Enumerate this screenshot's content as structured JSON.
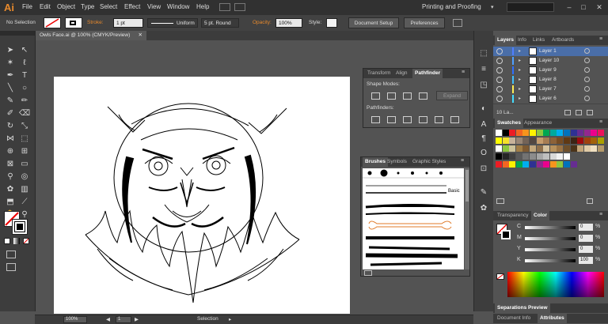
{
  "app": {
    "logo": "Ai"
  },
  "menu": [
    "File",
    "Edit",
    "Object",
    "Type",
    "Select",
    "Effect",
    "View",
    "Window",
    "Help"
  ],
  "workspace": "Printing and Proofing",
  "window_controls": {
    "minimize": "–",
    "maximize": "□",
    "close": "✕"
  },
  "control_bar": {
    "selection_label": "No Selection",
    "stroke_label": "Stroke:",
    "stroke_weight": "1 pt",
    "profile": "Uniform",
    "brush": "5 pt. Round",
    "opacity_label": "Opacity:",
    "opacity": "100%",
    "style_label": "Style:",
    "document_setup": "Document Setup",
    "preferences": "Preferences"
  },
  "document_tab": {
    "title": "Owls Face.ai @ 100% (CMYK/Preview)",
    "close": "✕"
  },
  "pathfinder_panel": {
    "tabs": [
      "Transform",
      "Align",
      "Pathfinder"
    ],
    "active_tab": "Pathfinder",
    "shape_modes_label": "Shape Modes:",
    "pathfinders_label": "Pathfinders:",
    "expand": "Expand"
  },
  "brushes_panel": {
    "tabs": [
      "Brushes",
      "Symbols",
      "Graphic Styles"
    ],
    "active_tab": "Brushes",
    "basic_label": "Basic"
  },
  "layers_panel": {
    "tabs": [
      "Layers",
      "Info",
      "Links",
      "Artboards"
    ],
    "active_tab": "Layers",
    "layers": [
      {
        "name": "Layer 1",
        "color": "#4f7fff",
        "selected": true
      },
      {
        "name": "Layer 10",
        "color": "#4fa0ff",
        "selected": false
      },
      {
        "name": "Layer 9",
        "color": "#2f6fff",
        "selected": false
      },
      {
        "name": "Layer 8",
        "color": "#3fbfff",
        "selected": false
      },
      {
        "name": "Layer 7",
        "color": "#ffee55",
        "selected": false
      },
      {
        "name": "Layer 6",
        "color": "#44ddff",
        "selected": false
      }
    ],
    "footer": "10 La..."
  },
  "swatches_panel": {
    "tabs": [
      "Swatches",
      "Appearance"
    ],
    "active_tab": "Swatches",
    "rows": [
      [
        "#ffffff",
        "#000000",
        "#ed1c24",
        "#f26522",
        "#f7941d",
        "#fff200",
        "#8dc63f",
        "#00a651",
        "#00a99d",
        "#00aeef",
        "#0072bc",
        "#2e3192",
        "#662d91",
        "#92278f",
        "#ec008c",
        "#ed145b"
      ],
      [
        "#ffff00",
        "#f5e02a",
        "#c7b299",
        "#998675",
        "#736357",
        "#534741",
        "#c69c6d",
        "#a67c52",
        "#8c6239",
        "#754c24",
        "#603913",
        "#3c2415",
        "#9e0b0f",
        "#a0410d",
        "#a36209",
        "#aba000"
      ],
      [
        "#ffffff",
        "#8dc63f",
        "#ccc299",
        "#a07d46",
        "#7e5a32",
        "#c4a87c",
        "#8f6f4a",
        "#d6c3a0",
        "#b7915c",
        "#9b7343",
        "#6e4f2a",
        "#4a3319",
        "#c2a57a",
        "#e0cba7",
        "#f0e0c0",
        "#b59a6a"
      ],
      [
        "#000000",
        "#262626",
        "#404040",
        "#595959",
        "#737373",
        "#8c8c8c",
        "#a6a6a6",
        "#bfbfbf",
        "#d9d9d9",
        "#f2f2f2",
        "#ffffff"
      ],
      [
        "#ed1c24",
        "#f26522",
        "#fff200",
        "#00a651",
        "#00aeef",
        "#2e3192",
        "#92278f",
        "#ec008c",
        "#f7941d",
        "#8dc63f",
        "#0072bc",
        "#662d91"
      ]
    ]
  },
  "color_panel": {
    "tabs": [
      "Transparency",
      "Color"
    ],
    "active_tab": "Color",
    "channels": [
      {
        "label": "C",
        "value": "0",
        "unit": "%"
      },
      {
        "label": "M",
        "value": "0",
        "unit": "%"
      },
      {
        "label": "Y",
        "value": "0",
        "unit": "%"
      },
      {
        "label": "K",
        "value": "100",
        "unit": "%"
      }
    ]
  },
  "separations": {
    "title": "Separations Preview"
  },
  "bottom_tabs": [
    "Document Info",
    "Attributes"
  ],
  "status_bar": {
    "zoom": "100%",
    "artboard": "1",
    "tool": "Selection"
  }
}
